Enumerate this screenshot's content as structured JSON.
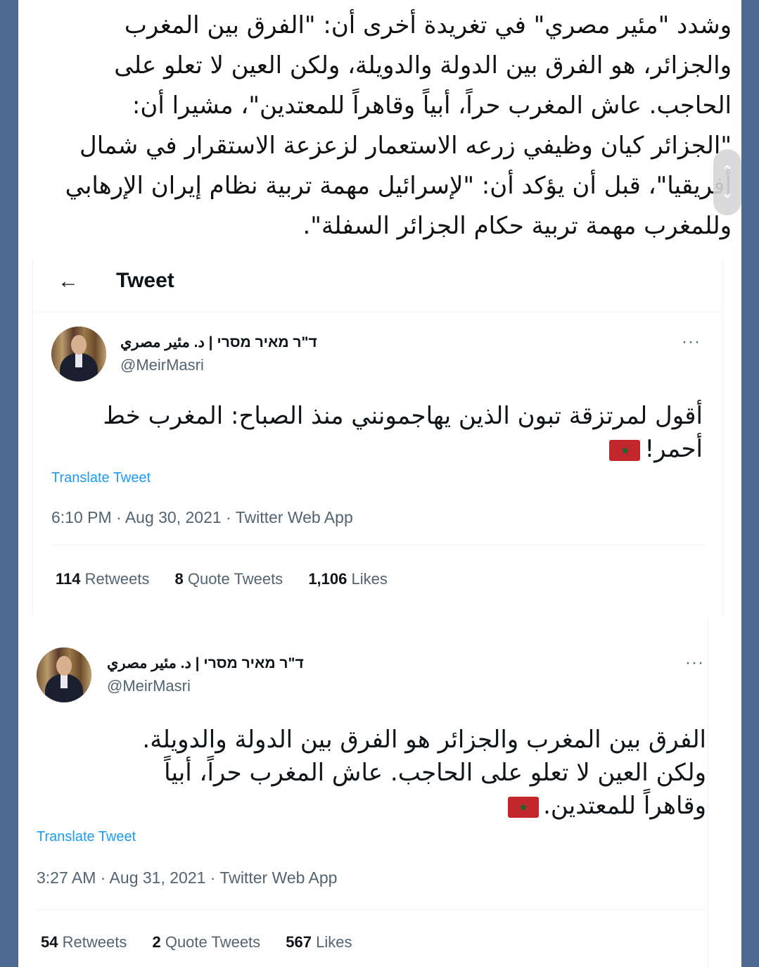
{
  "article": {
    "lines": [
      "وشدد \"مئير مصري\" في تغريدة أخرى أن: \"الفرق بين المغرب",
      "والجزائر، هو الفرق بين الدولة والدويلة، ولكن العين لا تعلو على",
      "الحاجب. عاش المغرب حراً، أبياً وقاهراً للمعتدين\"، مشيرا أن:",
      "\"الجزائر كيان وظيفي زرعه الاستعمار لزعزعة الاستقرار في شمال",
      "أفريقيا\"، قبل أن يؤكد أن: \"لإسرائيل مهمة تربية نظام إيران الإرهابي",
      "وللمغرب مهمة تربية حكام الجزائر السفلة\"."
    ]
  },
  "header": {
    "title": "Tweet",
    "back_icon": "arrow-left-icon"
  },
  "tweet1": {
    "author_name": "ד\"ר מאיר מסרי | د. مئير مصري",
    "handle": "@MeirMasri",
    "more": "···",
    "text_line1": "أقول لمرتزقة تبون الذين يهاجمونني منذ الصباح: المغرب خط",
    "text_line2": "أحمر!",
    "translate": "Translate Tweet",
    "timestamp": "6:10 PM · Aug 30, 2021 · Twitter Web App",
    "retweets": "114",
    "retweets_label": "Retweets",
    "quotes": "8",
    "quotes_label": "Quote Tweets",
    "likes": "1,106",
    "likes_label": "Likes"
  },
  "tweet2": {
    "author_name": "ד\"ר מאיר מסרי | د. مئير مصري",
    "handle": "@MeirMasri",
    "more": "···",
    "text_line1": "الفرق بين المغرب والجزائر هو الفرق بين الدولة والدويلة.",
    "text_line2": "ولكن العين لا تعلو على الحاجب. عاش المغرب حراً، أبياً",
    "text_line3": "وقاهراً للمعتدين.",
    "translate": "Translate Tweet",
    "timestamp": "3:27 AM · Aug 31, 2021 · Twitter Web App",
    "retweets": "54",
    "retweets_label": "Retweets",
    "quotes": "2",
    "quotes_label": "Quote Tweets",
    "likes": "567",
    "likes_label": "Likes"
  },
  "colors": {
    "link": "#1d9bf0",
    "frame": "#4c6a92",
    "flag": "#c1272d"
  },
  "icons": {
    "flag": "morocco-flag-icon"
  }
}
